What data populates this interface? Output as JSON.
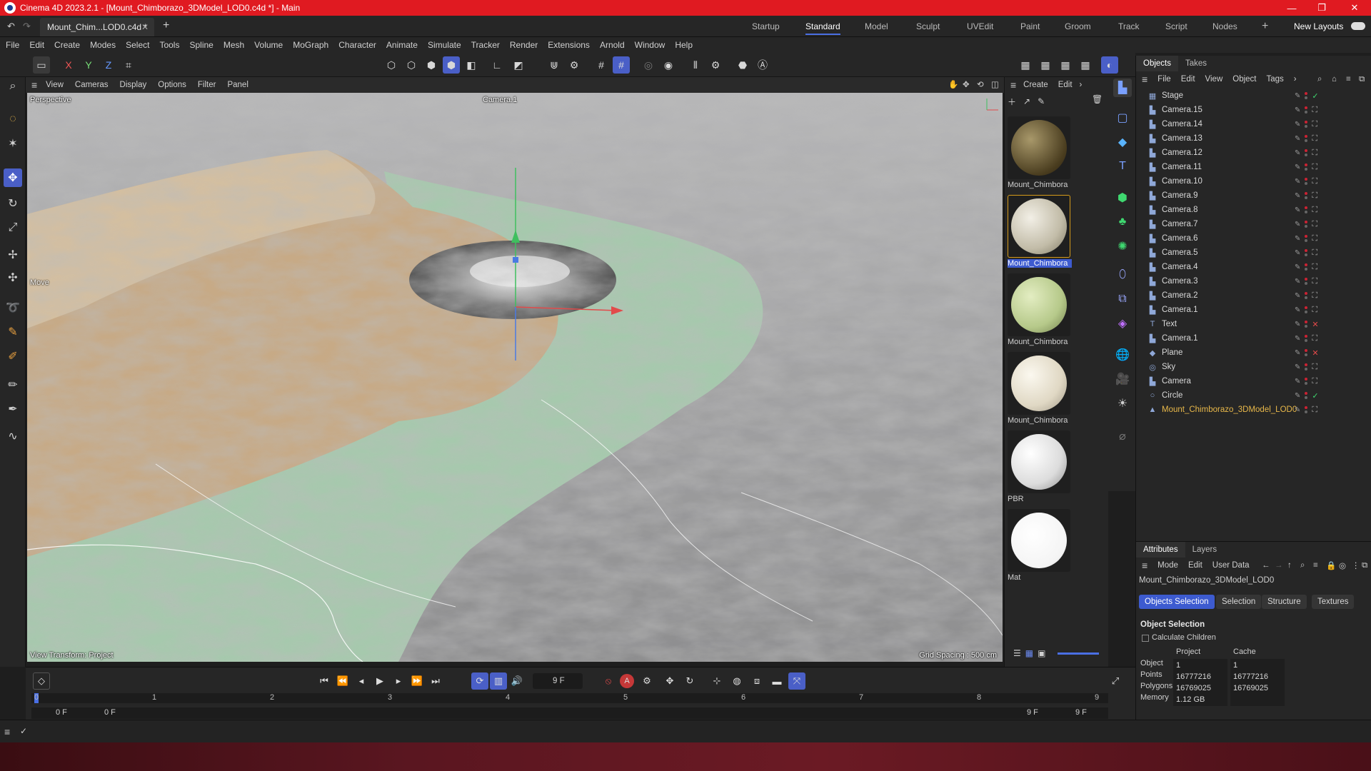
{
  "window": {
    "title": "Cinema 4D 2023.2.1 - [Mount_Chimborazo_3DModel_LOD0.c4d *] - Main",
    "minimize": "—",
    "maximize": "❐",
    "close": "✕"
  },
  "tabs": {
    "document": "Mount_Chim...LOD0.c4d *",
    "layouts": [
      "Startup",
      "Standard",
      "Model",
      "Sculpt",
      "UVEdit",
      "Paint",
      "Groom",
      "Track",
      "Script",
      "Nodes"
    ],
    "active_layout": "Standard",
    "new_layouts": "New Layouts"
  },
  "menu": [
    "File",
    "Edit",
    "Create",
    "Modes",
    "Select",
    "Tools",
    "Spline",
    "Mesh",
    "Volume",
    "MoGraph",
    "Character",
    "Animate",
    "Simulate",
    "Tracker",
    "Render",
    "Extensions",
    "Arnold",
    "Window",
    "Help"
  ],
  "axis_buttons": {
    "x": "X",
    "y": "Y",
    "z": "Z"
  },
  "viewport": {
    "menu": [
      "View",
      "Cameras",
      "Display",
      "Options",
      "Filter",
      "Panel"
    ],
    "projection": "Perspective",
    "camera": "Camera.1",
    "tool": "Move",
    "view_transform": "View Transform: Project",
    "grid_spacing": "Grid Spacing : 500 cm"
  },
  "materials": {
    "menu": [
      "Create",
      "Edit"
    ],
    "items": [
      {
        "name": "Mount_Chimbora",
        "color": "#5a4a2a"
      },
      {
        "name": "Mount_Chimbora",
        "color": "#c7c2b0"
      },
      {
        "name": "Mount_Chimbora",
        "color": "#b6c98a"
      },
      {
        "name": "Mount_Chimbora",
        "color": "#e6e0d0"
      },
      {
        "name": "PBR",
        "color": "#e8e8e8"
      },
      {
        "name": "Mat",
        "color": "#ffffff"
      }
    ]
  },
  "objects_panel": {
    "tabs": [
      "Objects",
      "Takes"
    ],
    "menu": [
      "File",
      "Edit",
      "View",
      "Object",
      "Tags"
    ],
    "items": [
      "Stage",
      "Camera.15",
      "Camera.14",
      "Camera.13",
      "Camera.12",
      "Camera.11",
      "Camera.10",
      "Camera.9",
      "Camera.8",
      "Camera.7",
      "Camera.6",
      "Camera.5",
      "Camera.4",
      "Camera.3",
      "Camera.2",
      "Camera.1",
      "Text",
      "Camera.1",
      "Plane",
      "Sky",
      "Camera",
      "Circle",
      "Mount_Chimborazo_3DModel_LOD0"
    ],
    "selected": "Mount_Chimborazo_3DModel_LOD0"
  },
  "attributes": {
    "tabs": [
      "Attributes",
      "Layers"
    ],
    "menu": [
      "Mode",
      "Edit",
      "User Data"
    ],
    "object_name": "Mount_Chimborazo_3DModel_LOD0",
    "buttons": [
      "Objects Selection",
      "Selection",
      "Structure",
      "Textures"
    ],
    "section": "Object Selection",
    "calc_children": "Calculate Children",
    "col_project": "Project",
    "col_cache": "Cache",
    "rows": [
      {
        "label": "Object",
        "project": "1",
        "cache": "1"
      },
      {
        "label": "Points",
        "project": "16777216",
        "cache": "16777216"
      },
      {
        "label": "Polygons",
        "project": "16769025",
        "cache": "16769025"
      },
      {
        "label": "Memory",
        "project": "1.12 GB",
        "cache": ""
      }
    ]
  },
  "timeline": {
    "current_frame": "9 F",
    "start": "0 F",
    "range_start": "0 F",
    "range_end": "9 F",
    "end": "9 F",
    "ticks": [
      "0",
      "1",
      "2",
      "3",
      "4",
      "5",
      "6",
      "7",
      "8",
      "9"
    ]
  },
  "colors": {
    "accent": "#4a5fc7",
    "titlebar": "#e01a21",
    "selected_obj": "#e8b84a"
  }
}
